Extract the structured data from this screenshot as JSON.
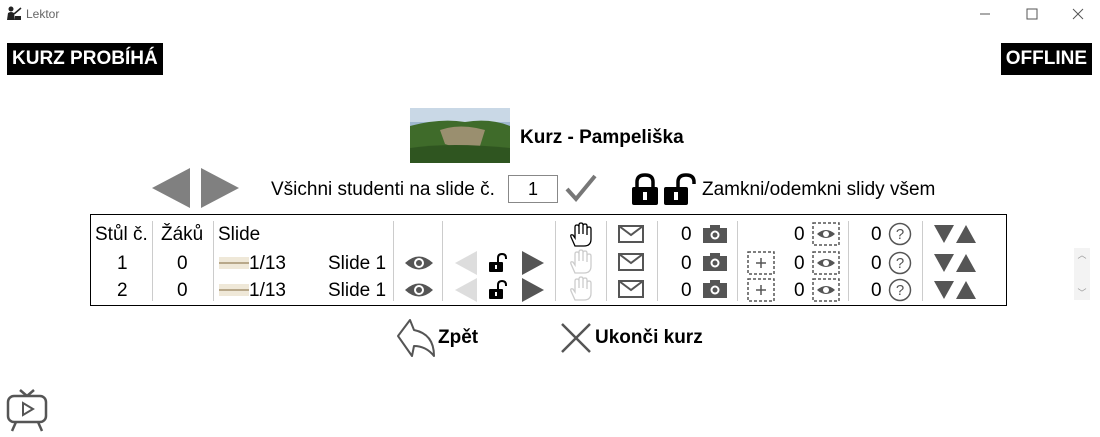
{
  "window": {
    "title": "Lektor",
    "icon": "teacher-icon"
  },
  "status": {
    "left_badge": "KURZ PROBÍHÁ",
    "right_badge": "OFFLINE"
  },
  "course": {
    "title": "Kurz - Pampeliška",
    "thumbnail": "landscape-thumbnail"
  },
  "controls": {
    "all_students_label": "Všichni studenti na slide č.",
    "slide_number": "1",
    "lock_label": "Zamkni/odemkni slidy všem"
  },
  "table": {
    "headers": {
      "table_no": "Stůl č.",
      "students": "Žáků",
      "slide": "Slide"
    },
    "header_counts": {
      "photos": "0",
      "views": "0",
      "questions": "0"
    },
    "rows": [
      {
        "table_no": "1",
        "students": "0",
        "slide_pos": "1/13",
        "slide_name": "Slide 1",
        "photos": "0",
        "views": "0",
        "questions": "0"
      },
      {
        "table_no": "2",
        "students": "0",
        "slide_pos": "1/13",
        "slide_name": "Slide 1",
        "photos": "0",
        "views": "0",
        "questions": "0"
      }
    ]
  },
  "actions": {
    "back_label": "Zpět",
    "end_label": "Ukonči kurz"
  },
  "colors": {
    "badge_bg": "#000000",
    "arrow_gray": "#808080",
    "disabled_gray": "#d0d0d0"
  }
}
